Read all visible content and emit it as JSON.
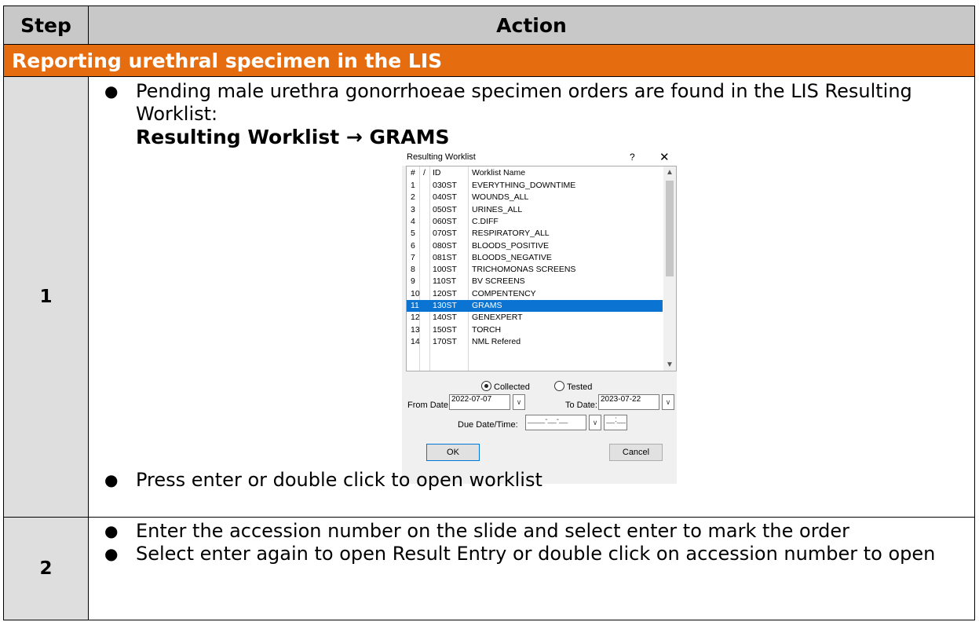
{
  "table": {
    "header_step": "Step",
    "header_action": "Action",
    "section_title": "Reporting urethral specimen in the LIS",
    "steps": [
      {
        "number": "1",
        "bullet1": "Pending male urethra gonorrhoeae specimen orders are found in the LIS Resulting Worklist:",
        "nav_path": "Resulting Worklist → GRAMS",
        "bullet2": "Press enter or double click to open worklist"
      },
      {
        "number": "2",
        "bullet1": "Enter the accession number on the slide and select enter to mark the order",
        "bullet2": "Select enter again to open Result Entry or double click on accession number to open"
      }
    ]
  },
  "dialog": {
    "title": "Resulting Worklist",
    "help_glyph": "?",
    "close_glyph": "✕",
    "columns": {
      "num": "#",
      "slash": "/",
      "id": "ID",
      "name": "Worklist Name"
    },
    "rows": [
      {
        "num": "1",
        "id": "030ST",
        "name": "EVERYTHING_DOWNTIME"
      },
      {
        "num": "2",
        "id": "040ST",
        "name": "WOUNDS_ALL"
      },
      {
        "num": "3",
        "id": "050ST",
        "name": "URINES_ALL"
      },
      {
        "num": "4",
        "id": "060ST",
        "name": "C.DIFF"
      },
      {
        "num": "5",
        "id": "070ST",
        "name": "RESPIRATORY_ALL"
      },
      {
        "num": "6",
        "id": "080ST",
        "name": "BLOODS_POSITIVE"
      },
      {
        "num": "7",
        "id": "081ST",
        "name": "BLOODS_NEGATIVE"
      },
      {
        "num": "8",
        "id": "100ST",
        "name": "TRICHOMONAS SCREENS"
      },
      {
        "num": "9",
        "id": "110ST",
        "name": "BV SCREENS"
      },
      {
        "num": "10",
        "id": "120ST",
        "name": "COMPENTENCY"
      },
      {
        "num": "11",
        "id": "130ST",
        "name": "GRAMS"
      },
      {
        "num": "12",
        "id": "140ST",
        "name": "GENEXPERT"
      },
      {
        "num": "13",
        "id": "150ST",
        "name": "TORCH"
      },
      {
        "num": "14",
        "id": "170ST",
        "name": "NML Refered"
      }
    ],
    "selected_row": "11",
    "radio_collected": "Collected",
    "radio_tested": "Tested",
    "selected_radio": "Collected",
    "from_date_label": "From Date:",
    "from_date_value": "2022-07-07",
    "to_date_label": "To Date:",
    "to_date_value": "2023-07-22",
    "due_label": "Due Date/Time:",
    "due_date_value": "____-__-__",
    "due_time_value": "__:__",
    "ok_label": "OK",
    "cancel_label": "Cancel"
  }
}
